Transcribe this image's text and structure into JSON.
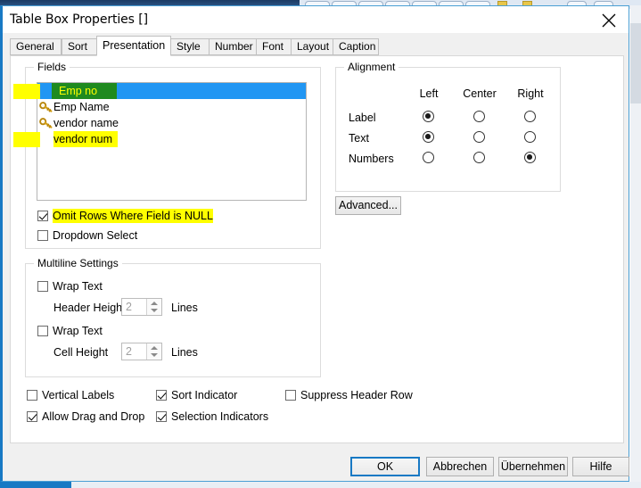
{
  "window": {
    "title": "Table Box Properties []",
    "close_icon": "close-icon"
  },
  "tabs": [
    {
      "label": "General",
      "active": false
    },
    {
      "label": "Sort",
      "active": false
    },
    {
      "label": "Presentation",
      "active": true
    },
    {
      "label": "Style",
      "active": false
    },
    {
      "label": "Number",
      "active": false
    },
    {
      "label": "Font",
      "active": false
    },
    {
      "label": "Layout",
      "active": false
    },
    {
      "label": "Caption",
      "active": false
    }
  ],
  "fields_group": {
    "legend": "Fields",
    "items": [
      {
        "label": "Emp no",
        "icon": null,
        "selected": true,
        "highlight": true
      },
      {
        "label": "Emp Name",
        "icon": "key-icon",
        "selected": false,
        "highlight": false
      },
      {
        "label": "vendor name",
        "icon": "key-icon",
        "selected": false,
        "highlight": false
      },
      {
        "label": "vendor num",
        "icon": null,
        "selected": false,
        "highlight": true
      }
    ],
    "omit_nulls": {
      "label": "Omit Rows Where Field is NULL",
      "checked": true,
      "highlight": true
    },
    "dropdown_select": {
      "label": "Dropdown Select",
      "checked": false,
      "highlight": false
    }
  },
  "alignment_group": {
    "legend": "Alignment",
    "columns": [
      "Left",
      "Center",
      "Right"
    ],
    "rows": [
      {
        "label": "Label",
        "selected": "Left"
      },
      {
        "label": "Text",
        "selected": "Left"
      },
      {
        "label": "Numbers",
        "selected": "Right"
      }
    ],
    "advanced_button": "Advanced..."
  },
  "multiline_group": {
    "legend": "Multiline Settings",
    "header": {
      "wrap_label": "Wrap Text",
      "wrap_checked": false,
      "height_label": "Header Height",
      "value": "2",
      "units": "Lines"
    },
    "cell": {
      "wrap_label": "Wrap Text",
      "wrap_checked": false,
      "height_label": "Cell Height",
      "value": "2",
      "units": "Lines"
    }
  },
  "options": [
    {
      "label": "Vertical Labels",
      "checked": false
    },
    {
      "label": "Sort Indicator",
      "checked": true
    },
    {
      "label": "Suppress Header Row",
      "checked": false
    },
    {
      "label": "Allow Drag and Drop",
      "checked": true
    },
    {
      "label": "Selection Indicators",
      "checked": true
    }
  ],
  "buttons": [
    {
      "label": "OK",
      "default": true
    },
    {
      "label": "Abbrechen",
      "default": false
    },
    {
      "label": "Übernehmen",
      "default": false
    },
    {
      "label": "Hilfe",
      "default": false
    }
  ],
  "colors": {
    "selection_blue": "#2196f3",
    "highlight_yellow": "#ffff00",
    "marker_green": "#1f8a1f",
    "accent_blue": "#1879c4"
  }
}
